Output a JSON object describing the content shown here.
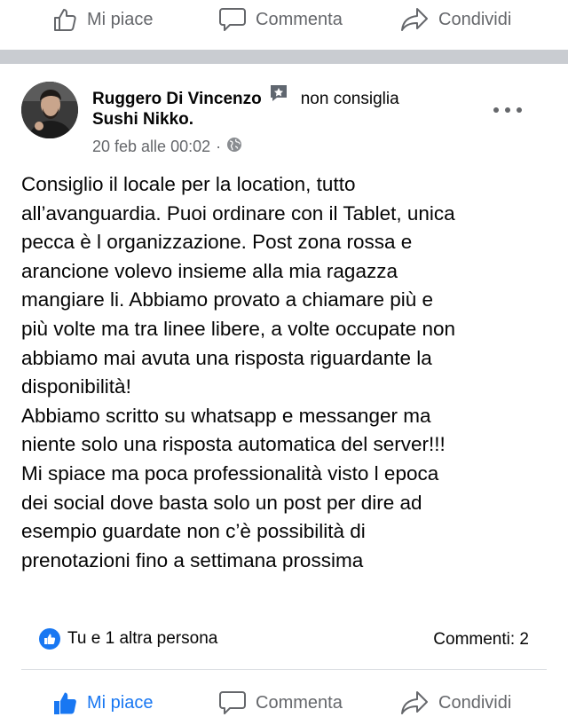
{
  "top_actions": {
    "like_label": "Mi piace",
    "comment_label": "Commenta",
    "share_label": "Condividi"
  },
  "post": {
    "author": "Ruggero Di Vincenzo",
    "verb": "non consiglia",
    "page": "Sushi Nikko.",
    "timestamp": "20 feb alle 00:02",
    "meta_separator": "·",
    "body_lines": [
      "Consiglio il locale per la location, tutto",
      "all’avanguardia. Puoi ordinare con il Tablet, unica",
      "pecca è l organizzazione. Post zona rossa e",
      "arancione volevo insieme alla mia ragazza",
      "mangiare li. Abbiamo provato a chiamare più e",
      "più volte ma tra linee libere, a volte occupate non",
      "abbiamo mai avuta una risposta riguardante la",
      "disponibilità!",
      "Abbiamo scritto su whatsapp e messanger ma",
      "niente solo una risposta automatica del server!!!",
      "Mi spiace ma poca professionalità visto l epoca",
      "dei social dove basta solo un post per dire ad",
      "esempio guardate non c’è possibilità di",
      "prenotazioni fino a settimana prossima"
    ],
    "likes_text": "Tu e 1 altra persona",
    "comments_text": "Commenti: 2"
  },
  "bottom_actions": {
    "like_label": "Mi piace",
    "comment_label": "Commenta",
    "share_label": "Condividi"
  },
  "colors": {
    "accent": "#1877f2",
    "secondary_text": "#65676b",
    "separator": "#c9ccd1"
  },
  "icons": [
    "thumbs-up-icon",
    "comment-icon",
    "share-icon",
    "review-badge-icon",
    "globe-icon",
    "more-options-icon",
    "like-reaction-icon"
  ]
}
